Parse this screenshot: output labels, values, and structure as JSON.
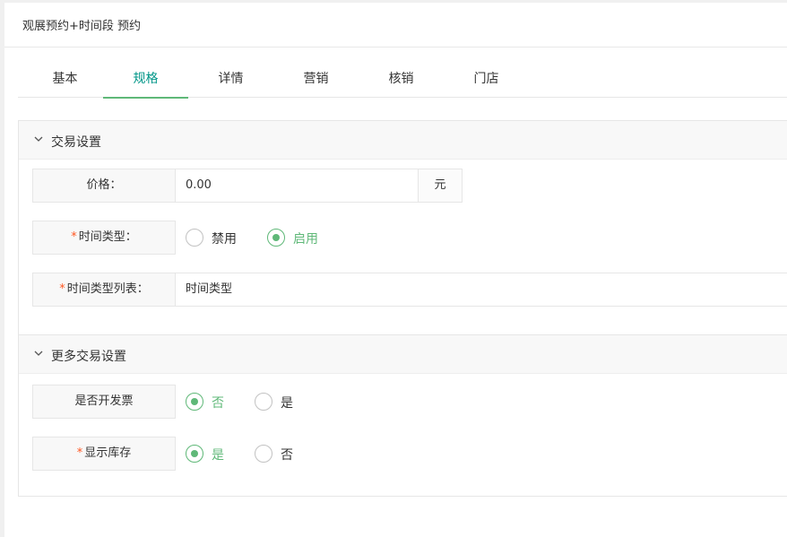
{
  "header": {
    "title": "观展预约+时间段 预约"
  },
  "tabs": [
    {
      "label": "基本",
      "active": false
    },
    {
      "label": "规格",
      "active": true
    },
    {
      "label": "详情",
      "active": false
    },
    {
      "label": "营销",
      "active": false
    },
    {
      "label": "核销",
      "active": false
    },
    {
      "label": "门店",
      "active": false
    }
  ],
  "trade_section": {
    "title": "交易设置",
    "price": {
      "label": "价格：",
      "value": "0.00",
      "suffix": "元"
    },
    "time_type": {
      "required": "*",
      "label": "时间类型：",
      "options": [
        "禁用",
        "启用"
      ],
      "selected": "启用"
    },
    "time_type_list": {
      "required": "*",
      "label": "时间类型列表：",
      "value": "时间类型"
    }
  },
  "more_section": {
    "title": "更多交易设置",
    "invoice": {
      "label": "是否开发票",
      "options": [
        "否",
        "是"
      ],
      "selected": "否"
    },
    "show_stock": {
      "required": "*",
      "label": "显示库存",
      "options": [
        "是",
        "否"
      ],
      "selected": "是"
    }
  },
  "colors": {
    "accent": "#5fb878",
    "tab_active": "#009688",
    "required": "#ff5722"
  }
}
